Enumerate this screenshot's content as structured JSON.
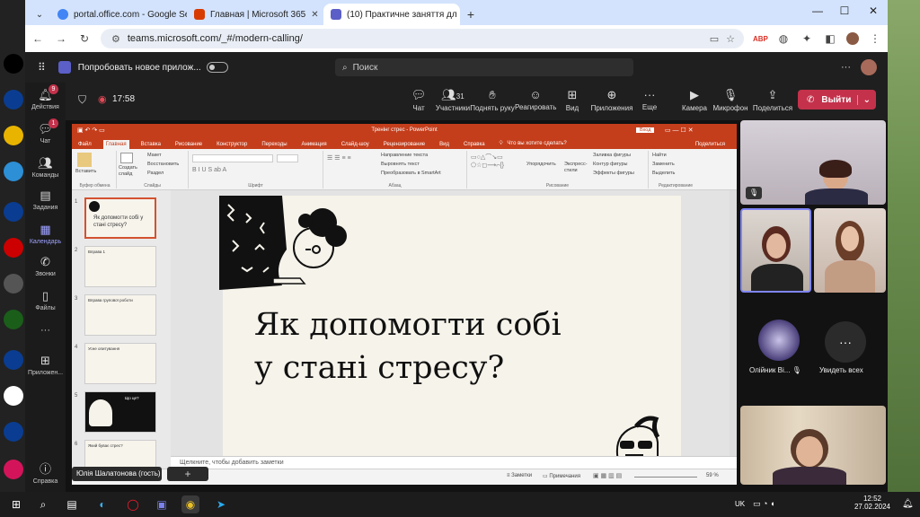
{
  "browser": {
    "tabs": [
      {
        "title": "portal.office.com - Google Sear",
        "color": "#4285f4"
      },
      {
        "title": "Главная | Microsoft 365",
        "color": "#d83b01"
      },
      {
        "title": "(10) Практичне заняття дл",
        "color": "#5b5fc7"
      }
    ],
    "new_tab": "+",
    "url": "teams.microsoft.com/_#/modern-calling/"
  },
  "teams": {
    "promo_label": "Попробовать новое прилож...",
    "search_placeholder": "Поиск",
    "more": "···",
    "sidebar": [
      {
        "label": "Действия",
        "icon": "bell-icon",
        "badge": "9"
      },
      {
        "label": "Чат",
        "icon": "chat-icon",
        "badge": "1"
      },
      {
        "label": "Команды",
        "icon": "teams-icon",
        "badge": ""
      },
      {
        "label": "Задания",
        "icon": "assignments-icon",
        "badge": ""
      },
      {
        "label": "Календарь",
        "icon": "calendar-icon",
        "badge": ""
      },
      {
        "label": "Звонки",
        "icon": "phone-icon",
        "badge": ""
      },
      {
        "label": "Файлы",
        "icon": "files-icon",
        "badge": ""
      },
      {
        "label": "···",
        "icon": "more-icon",
        "badge": ""
      },
      {
        "label": "Приложен...",
        "icon": "apps-icon",
        "badge": ""
      },
      {
        "label": "Справка",
        "icon": "help-icon",
        "badge": ""
      }
    ],
    "meeting": {
      "timer": "17:58",
      "tools": [
        {
          "label": "Чат",
          "icon": "chat-icon"
        },
        {
          "label": "Участники",
          "icon": "people-icon",
          "count": "31"
        },
        {
          "label": "Поднять руку",
          "icon": "hand-icon"
        },
        {
          "label": "Реагировать",
          "icon": "smile-icon"
        },
        {
          "label": "Вид",
          "icon": "grid-icon"
        },
        {
          "label": "Приложения",
          "icon": "plus-icon"
        },
        {
          "label": "Еще",
          "icon": "more-icon"
        },
        {
          "label": "Камера",
          "icon": "camera-icon"
        },
        {
          "label": "Микрофон",
          "icon": "mic-icon"
        },
        {
          "label": "Поделиться",
          "icon": "share-icon"
        }
      ],
      "leave_label": "Выйти"
    },
    "speaker_name": "Юлія Шалатонова (гость)",
    "participants": {
      "name1": "Олійник Ві...",
      "see_all": "Увидеть всех"
    }
  },
  "powerpoint": {
    "title": "Тренінг стрес - PowerPoint",
    "sign_in": "Вход",
    "tabs": [
      "Файл",
      "Главная",
      "Вставка",
      "Рисование",
      "Конструктор",
      "Переходы",
      "Анимация",
      "Слайд-шоу",
      "Рецензирование",
      "Вид",
      "Справка"
    ],
    "tell_me": "Что вы хотите сделать?",
    "share": "Поделиться",
    "ribbon": {
      "paste": "Вставить",
      "clipboard": "Буфер обмена",
      "new_slide": "Создать слайд",
      "layout": "Макет",
      "reset": "Восстановить",
      "section": "Раздел",
      "slides": "Слайды",
      "font": "Шрифт",
      "paragraph": "Абзац",
      "text_direction": "Направление текста",
      "align_text": "Выровнять текст",
      "smartart": "Преобразовать в SmartArt",
      "arrange": "Упорядочить",
      "quick_styles": "Экспресс-стили",
      "fill": "Заливка фигуры",
      "outline": "Контур фигуры",
      "effects": "Эффекты фигуры",
      "drawing": "Рисование",
      "find": "Найти",
      "replace": "Заменить",
      "select": "Выделить",
      "editing": "Редактирование"
    },
    "thumbnails": [
      {
        "num": "1",
        "text": "Як допомогти собі у стані стресу?"
      },
      {
        "num": "2",
        "text": "Вправа 1"
      },
      {
        "num": "3",
        "text": "Вправа групової роботи"
      },
      {
        "num": "4",
        "text": "Усне опитування"
      },
      {
        "num": "5",
        "text": "Що це?"
      },
      {
        "num": "6",
        "text": "Який буває стрес?"
      }
    ],
    "slide_title": "Як допомогти собі\nу стані стресу?",
    "notes_placeholder": "Щелкните, чтобы добавить заметки",
    "status": {
      "notes": "Заметки",
      "comments": "Примечания",
      "zoom": "59 %"
    }
  },
  "taskbar": {
    "lang": "UK",
    "time": "12:52",
    "date": "27.02.2024"
  },
  "colors": {
    "teams_accent": "#9ea2ff",
    "leave": "#c4314b",
    "ppt": "#c43e1c"
  }
}
